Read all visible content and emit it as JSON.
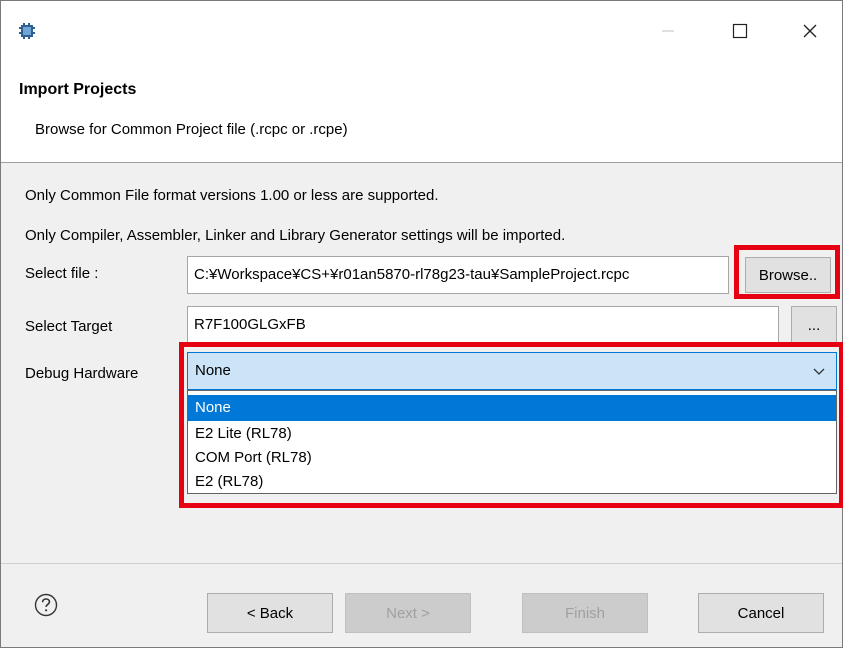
{
  "dialog": {
    "title": "Import Projects",
    "description": "Browse for Common Project file (.rcpc or .rcpe)"
  },
  "notes": {
    "line1": "Only Common File format versions 1.00 or less are supported.",
    "line2": "Only Compiler, Assembler, Linker and Library Generator settings will be imported."
  },
  "form": {
    "select_file_label": "Select file :",
    "select_file_value": "C:¥Workspace¥CS+¥r01an5870-rl78g23-tau¥SampleProject.rcpc",
    "browse_label": "Browse..",
    "select_target_label": "Select Target",
    "select_target_value": "R7F100GLGxFB",
    "target_browse_label": "...",
    "debug_hardware_label": "Debug Hardware",
    "debug_hardware_selected": "None",
    "debug_hardware_options": [
      "None",
      "E2 Lite (RL78)",
      "COM Port (RL78)",
      "E2 (RL78)"
    ]
  },
  "footer": {
    "back_label": "< Back",
    "next_label": "Next >",
    "finish_label": "Finish",
    "cancel_label": "Cancel"
  },
  "colors": {
    "highlight": "#e60012",
    "selection": "#0078d7",
    "combo_bg": "#cce4f7",
    "panel_bg": "#f0f0f0"
  },
  "icons": {
    "app": "chip-icon",
    "help": "help-icon",
    "minimize": "minimize-icon",
    "maximize": "maximize-icon",
    "close": "close-icon",
    "dropdown": "chevron-down-icon"
  }
}
